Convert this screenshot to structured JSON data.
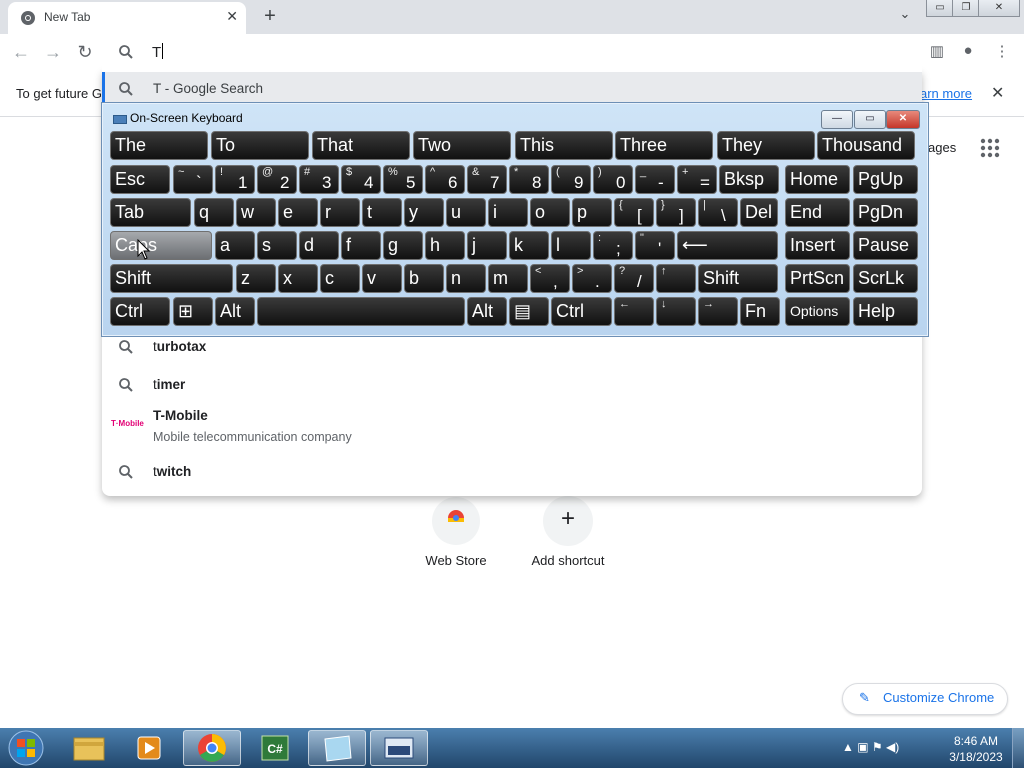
{
  "browser": {
    "tab_title": "New Tab",
    "tab_close": "✕",
    "new_tab": "+",
    "tab_search": "⌄",
    "window_controls": {
      "minimize": "▭",
      "restore": "❐",
      "close": "✕"
    }
  },
  "toolbar": {
    "back": "←",
    "forward": "→",
    "reload": "↻",
    "omnibox_value": "T",
    "side_panel": "▥",
    "profile": "●",
    "menu": "⋮"
  },
  "infobar": {
    "text": "To get future G",
    "learn_more": "arn more",
    "close": "✕"
  },
  "suggestions": [
    {
      "prefix": "T",
      "rest": " - Google Search",
      "type": "search",
      "icon": "search-icon"
    },
    {
      "prefix": "t",
      "rest": "urbotax",
      "type": "search",
      "icon": "search-icon"
    },
    {
      "prefix": "t",
      "rest": "imer",
      "type": "search",
      "icon": "search-icon"
    },
    {
      "prefix": "T",
      "rest": "-Mobile",
      "sub": "Mobile telecommunication company",
      "type": "entity",
      "icon": "t-mobile-logo",
      "logo_text": "T·Mobile"
    },
    {
      "prefix": "t",
      "rest": "witch",
      "type": "search",
      "icon": "search-icon"
    }
  ],
  "newtab_page": {
    "images_link": "ages",
    "shortcuts": [
      {
        "label": "Web Store",
        "icon": "chrome-web-store-icon"
      },
      {
        "label": "Add shortcut",
        "icon": "plus-icon",
        "glyph": "+"
      }
    ],
    "customize": {
      "label": "Customize Chrome",
      "icon": "pencil-icon",
      "glyph": "✎"
    }
  },
  "osk": {
    "title": "On-Screen Keyboard",
    "predictions": [
      "The",
      "To",
      "That",
      "Two",
      "This",
      "Three",
      "They",
      "Thousand"
    ],
    "row1": [
      {
        "m": "Esc"
      },
      {
        "s": "~",
        "n": "`"
      },
      {
        "s": "!",
        "n": "1"
      },
      {
        "s": "@",
        "n": "2"
      },
      {
        "s": "#",
        "n": "3"
      },
      {
        "s": "$",
        "n": "4"
      },
      {
        "s": "%",
        "n": "5"
      },
      {
        "s": "^",
        "n": "6"
      },
      {
        "s": "&",
        "n": "7"
      },
      {
        "s": "*",
        "n": "8"
      },
      {
        "s": "(",
        "n": "9"
      },
      {
        "s": ")",
        "n": "0"
      },
      {
        "s": "_",
        "n": "-"
      },
      {
        "s": "+",
        "n": "="
      },
      {
        "m": "Bksp"
      },
      {
        "m": "Home"
      },
      {
        "m": "PgUp"
      }
    ],
    "row2": [
      {
        "m": "Tab"
      },
      {
        "m": "q"
      },
      {
        "m": "w"
      },
      {
        "m": "e"
      },
      {
        "m": "r"
      },
      {
        "m": "t"
      },
      {
        "m": "y"
      },
      {
        "m": "u"
      },
      {
        "m": "i"
      },
      {
        "m": "o"
      },
      {
        "m": "p"
      },
      {
        "s": "{",
        "n": "["
      },
      {
        "s": "}",
        "n": "]"
      },
      {
        "s": "|",
        "n": "\\"
      },
      {
        "m": "Del"
      },
      {
        "m": "End"
      },
      {
        "m": "PgDn"
      }
    ],
    "row3": [
      {
        "m": "Caps"
      },
      {
        "m": "a"
      },
      {
        "m": "s"
      },
      {
        "m": "d"
      },
      {
        "m": "f"
      },
      {
        "m": "g"
      },
      {
        "m": "h"
      },
      {
        "m": "j"
      },
      {
        "m": "k"
      },
      {
        "m": "l"
      },
      {
        "s": ":",
        "n": ";"
      },
      {
        "s": "\"",
        "n": "'"
      },
      {
        "m": "⟵"
      },
      {
        "m": "Insert"
      },
      {
        "m": "Pause"
      }
    ],
    "row4": [
      {
        "m": "Shift"
      },
      {
        "m": "z"
      },
      {
        "m": "x"
      },
      {
        "m": "c"
      },
      {
        "m": "v"
      },
      {
        "m": "b"
      },
      {
        "m": "n"
      },
      {
        "m": "m"
      },
      {
        "s": "<",
        "n": ","
      },
      {
        "s": ">",
        "n": "."
      },
      {
        "s": "?",
        "n": "/"
      },
      {
        "s": "↑",
        "n": ""
      },
      {
        "m": "Shift"
      },
      {
        "m": "PrtScn"
      },
      {
        "m": "ScrLk"
      }
    ],
    "row5": [
      {
        "m": "Ctrl"
      },
      {
        "m": "⊞"
      },
      {
        "m": "Alt"
      },
      {
        "m": ""
      },
      {
        "m": "Alt"
      },
      {
        "m": "▤"
      },
      {
        "m": "Ctrl"
      },
      {
        "s": "←",
        "n": ""
      },
      {
        "s": "↓",
        "n": ""
      },
      {
        "s": "→",
        "n": ""
      },
      {
        "m": "Fn"
      },
      {
        "m": "Options"
      },
      {
        "m": "Help"
      }
    ]
  },
  "taskbar": {
    "time": "8:46 AM",
    "date": "3/18/2023",
    "apps": [
      "windows-explorer-icon",
      "media-player-icon",
      "chrome-icon",
      "csharp-icon",
      "notepad-icon",
      "on-screen-keyboard-icon"
    ],
    "tray": "▲  ▣  ⚑  ◀)"
  }
}
